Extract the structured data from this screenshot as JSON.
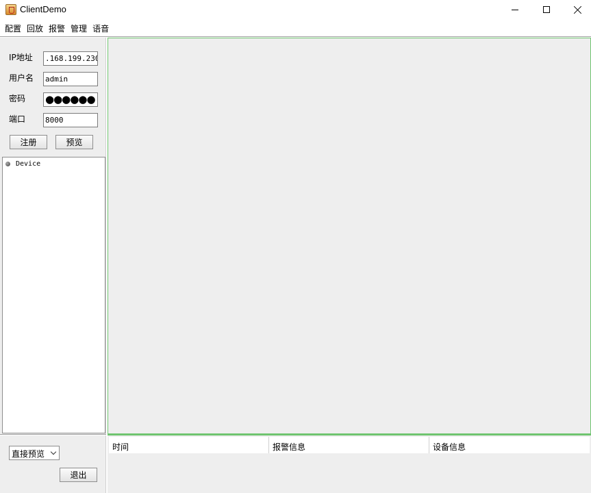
{
  "window": {
    "title": "ClientDemo",
    "icon": "java-cup-icon"
  },
  "menu": {
    "items": [
      "配置",
      "回放",
      "报警",
      "管理",
      "语音"
    ]
  },
  "login_form": {
    "ip_label": "IP地址",
    "ip_value": ".168.199.230",
    "user_label": "用户名",
    "user_value": "admin",
    "password_label": "密码",
    "password_value": "●●●●●●",
    "port_label": "端口",
    "port_value": "8000",
    "register_button": "注册",
    "preview_button": "预览"
  },
  "device_tree": {
    "root": "Device"
  },
  "bottom_left": {
    "preview_mode": "直接预览",
    "exit_button": "退出"
  },
  "alarm_table": {
    "columns": [
      "时间",
      "报警信息",
      "设备信息"
    ]
  },
  "colors": {
    "panel_bg": "#eeeeee",
    "video_border": "#6fc46f"
  }
}
